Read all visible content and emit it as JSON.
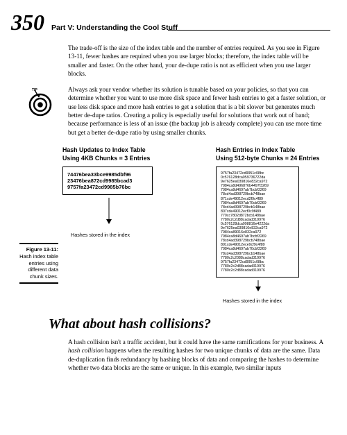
{
  "header": {
    "page_number": "350",
    "part_title": "Part V: Understanding the Cool Stuff"
  },
  "para1": "The trade-off is the size of the index table and the number of entries required. As you see in Figure 13-11, fewer hashes are required when you use larger blocks; therefore, the index table will be smaller and faster. On the other hand, your de-dupe ratio is not as efficient when you use larger blocks.",
  "tip": {
    "label": "TIP",
    "text": "Always ask your vendor whether its solution is tunable based on your policies, so that you can determine whether you want to use more disk space and fewer hash entries to get a faster solution, or use less disk space and more hash entries to get a solution that is a bit slower but generates much better de-dupe ratios. Creating a policy is especially useful for solutions that work out of band; because performance is less of an issue (the backup job is already complete) you can use more time but get a better de-dupe ratio by using smaller chunks."
  },
  "diagram": {
    "left": {
      "title1": "Hash Updates to Index Table",
      "title2": "Using 4KB Chunks = 3 Entries",
      "hashes": [
        "74476bea33bce9985dbf96",
        "23476bea872cd9985bcad3",
        "9757fa23472cd9985b76bc"
      ],
      "caption": "Hashes stored in the index"
    },
    "right": {
      "title1": "Hash Entries in Index Table",
      "title2": "Using 512-byte Chunks = 24 Entries",
      "hashes": [
        "9757fa23472cd9951c08bc",
        "0c576128dca059736722da",
        "9e7625ea039816e832ca972",
        "7984ca8d496876b4497f3269",
        "7984ca8d4697ab7bcbf3269",
        "78cd4ad398729bcb748bae",
        "871cde49012ecd2f9c4f89",
        "7984ca8d4697ab70cbf3269",
        "78cd4ad398729bcb148bae",
        "807cde49012ecf0c9f489",
        "770cc7802d872bcb148bae",
        "7780c2c2d88cadad319976",
        "0c576128dca098816e4222da",
        "9e7625ea039816e832ca972",
        "7984ca89016e832ca972",
        "7984ca8d4697ab7bcbf3269",
        "78cd4ad398729bcb748bae",
        "891cde49012ece9cf9c4f89",
        "7984ca8d4697ab70cbf3269",
        "78cd4ad398729bcb148bae",
        "7780c2c2088cadad319976",
        "9757fa23472cd9951c08bc",
        "7780c2c2d88cadad319976",
        "7780c2c2d88cadad319976"
      ],
      "caption": "Hashes stored in the index"
    }
  },
  "figure_caption": {
    "label": "Figure 13-11:",
    "text": "Hash index table entries using different data chunk sizes."
  },
  "section_title": "What about hash collisions?",
  "para2_a": "A hash collision isn't a traffic accident, but it could have the same ramifications for your business. A ",
  "para2_em": "hash collision",
  "para2_b": " happens when the resulting hashes for two unique chunks of data are the same. Data de-duplication finds redundancy by hashing blocks of data and comparing the hashes to determine whether two data blocks are the same or unique. In this example, two similar inputs"
}
